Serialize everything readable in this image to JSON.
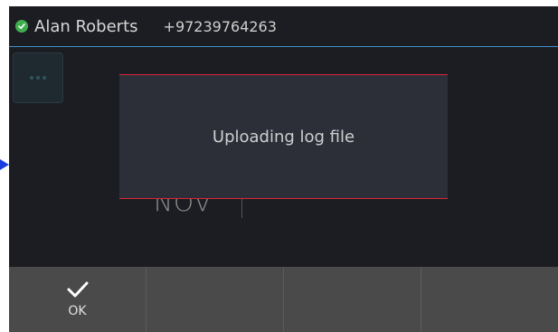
{
  "header": {
    "status": "available",
    "user_name": "Alan Roberts",
    "user_number": "+97239764263"
  },
  "main": {
    "date_text": "NOV"
  },
  "dialog": {
    "message": "Uploading log file"
  },
  "softkeys": [
    {
      "label": "OK",
      "icon": "check-icon"
    },
    {
      "label": ""
    },
    {
      "label": ""
    },
    {
      "label": ""
    }
  ],
  "colors": {
    "accent_line": "#3f8fc9",
    "dialog_border": "#d82636",
    "status_green": "#3fae4e"
  }
}
